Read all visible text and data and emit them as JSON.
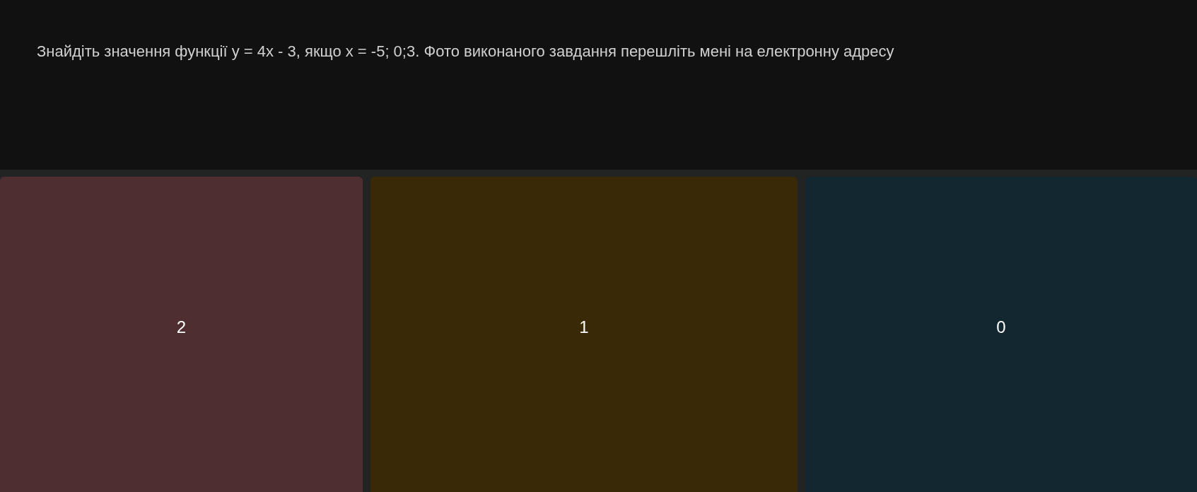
{
  "question": {
    "text": "Знайдіть значення функції y = 4x - 3, якщо x = -5; 0;3. Фото виконаного завдання перешліть мені на електронну адресу"
  },
  "options": [
    {
      "label": "2",
      "color": "#4f2e32"
    },
    {
      "label": "1",
      "color": "#3a2907"
    },
    {
      "label": "0",
      "color": "#132730"
    }
  ]
}
